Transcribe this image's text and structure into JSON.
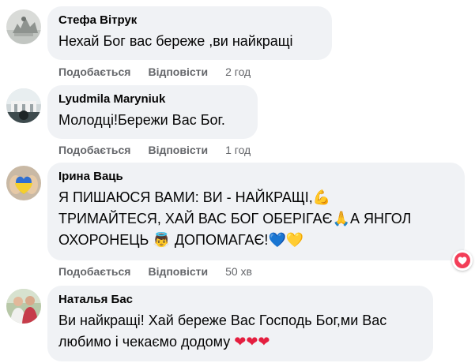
{
  "comments": [
    {
      "author": "Стефа Вітрук",
      "text": "Нехай Бог вас береже ,ви найкращі",
      "like_label": "Подобається",
      "reply_label": "Відповісти",
      "time": "2 год"
    },
    {
      "author": "Lyudmila Maryniuk",
      "text": "Молодці!Бережи Вас Бог.",
      "like_label": "Подобається",
      "reply_label": "Відповісти",
      "time": "1 год"
    },
    {
      "author": "Ірина Ваць",
      "text_line1": "Я ПИШАЮСЯ ВАМИ: ВИ - НАЙКРАЩІ,",
      "text_line2a": "ТРИМАЙТЕСЯ, ХАЙ ВАС БОГ ОБЕРІГАЄ",
      "text_line2b": "А ЯНГОЛ",
      "text_line3a": "ОХОРОНЕЦЬ",
      "text_line3b": "ДОПОМАГАЄ!",
      "emoji_muscle": "💪",
      "emoji_pray": "🙏",
      "emoji_angel": "👼",
      "emoji_hearts": "💙💛",
      "like_label": "Подобається",
      "reply_label": "Відповісти",
      "time": "50 хв",
      "reaction_icon": "heart-icon"
    },
    {
      "author": "Наталья Бас",
      "text_line1": "Ви найкращі! Хай береже Вас Господь Бог,ми Вас",
      "text_line2": "любимо і чекаємо додому",
      "emoji_hearts": "❤❤❤",
      "like_label": "Подобається",
      "reply_label": "Відповісти"
    }
  ],
  "colors": {
    "bubble": "#f0f2f5",
    "meta_text": "#65676b",
    "love_reaction": "#f33e58",
    "heart_red": "#e41e3f"
  }
}
